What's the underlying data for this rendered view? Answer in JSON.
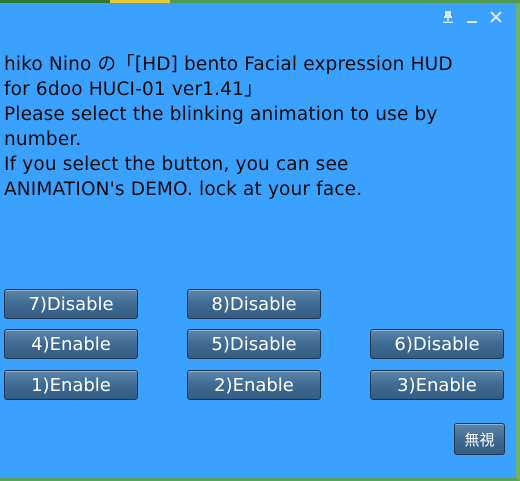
{
  "dialog": {
    "message_lines": [
      "hiko Nino の「[HD] bento Facial expression HUD",
      "for 6doo HUCI-01 ver1.41」",
      "Please select the blinking animation to use by",
      "number.",
      "If you select the button, you can see",
      "ANIMATION's DEMO. lock at your face."
    ],
    "controls": {
      "pin_icon": "pin-down-icon",
      "minimize_icon": "minimize-icon",
      "close_icon": "close-icon"
    }
  },
  "buttons": {
    "b7": "7)Disable",
    "b8": "8)Disable",
    "b4": "4)Enable",
    "b5": "5)Disable",
    "b6": "6)Disable",
    "b1": "1)Enable",
    "b2": "2)Enable",
    "b3": "3)Enable",
    "ignore": "無視"
  },
  "colors": {
    "dialog_background": "#3ba1ff",
    "button_background": "#3f6a92",
    "button_text": "#ffffff",
    "message_text": "#0b0b0b"
  }
}
